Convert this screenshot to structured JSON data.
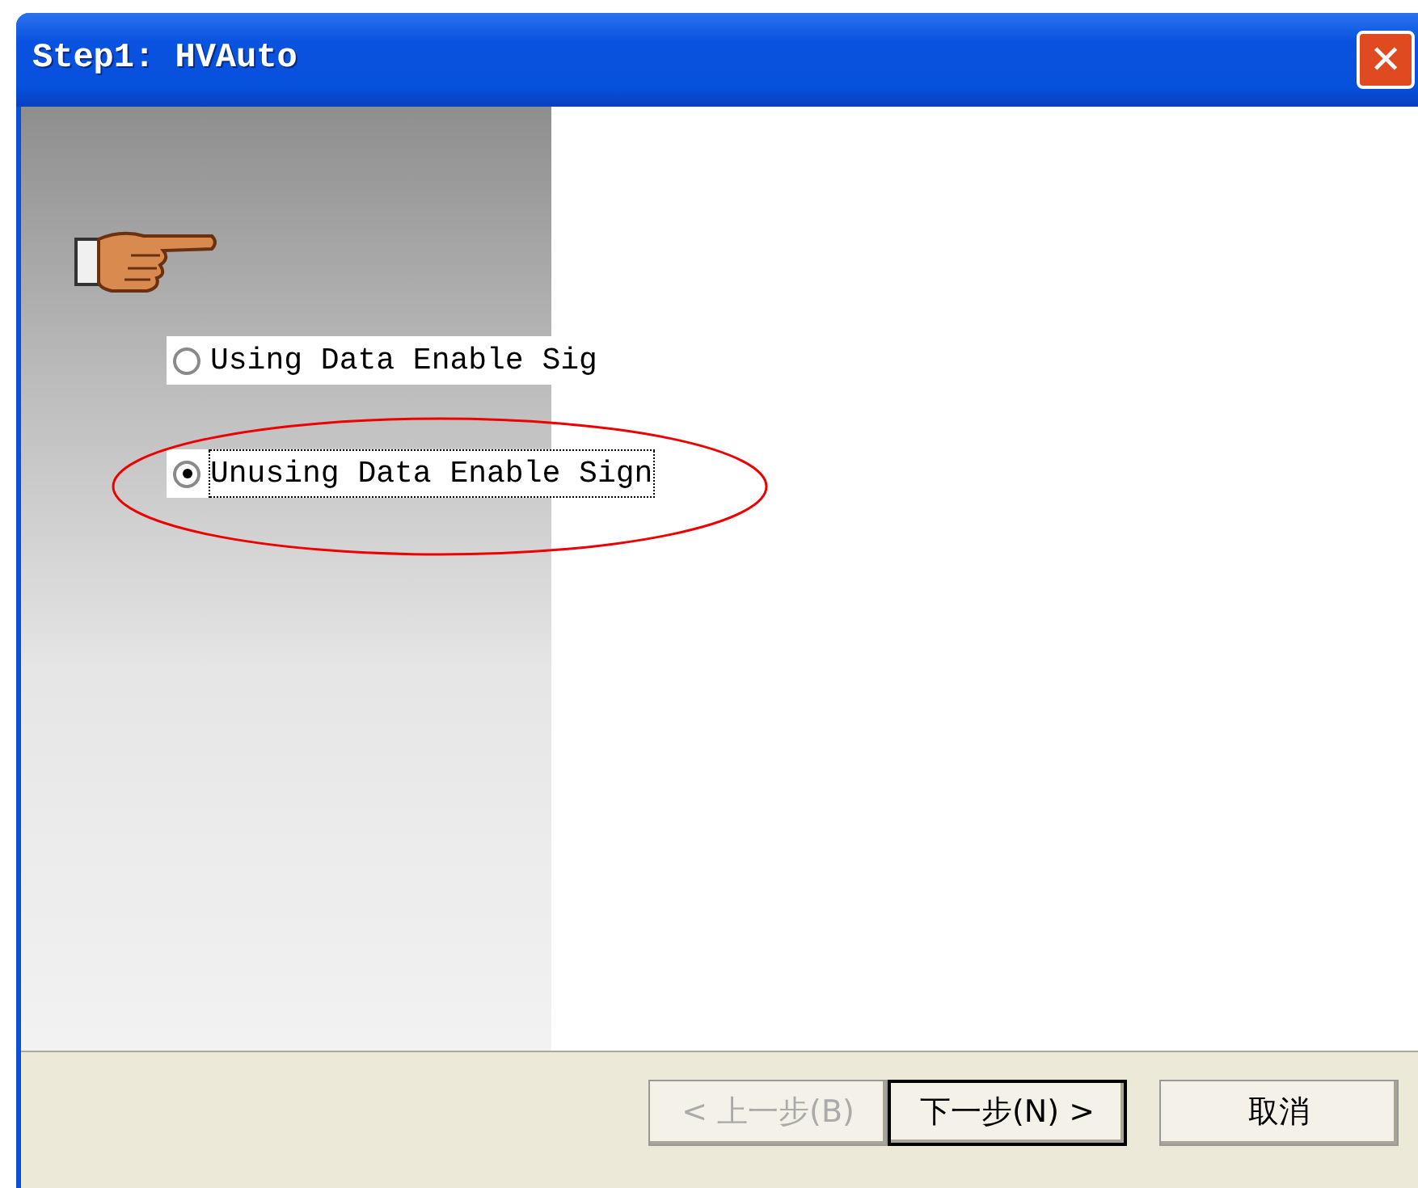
{
  "window": {
    "title": "Step1: HVAuto",
    "close_label": "✕"
  },
  "options": [
    {
      "label": "Using Data Enable Sig",
      "selected": false,
      "focused": false,
      "annotated": false
    },
    {
      "label": "Unusing Data Enable Sign",
      "selected": true,
      "focused": true,
      "annotated": true
    }
  ],
  "buttons": [
    {
      "label": "< 上一步(B)",
      "disabled": true,
      "default": false
    },
    {
      "label": "下一步(N) >",
      "disabled": false,
      "default": true
    },
    {
      "label": "取消",
      "disabled": false,
      "default": false
    }
  ]
}
